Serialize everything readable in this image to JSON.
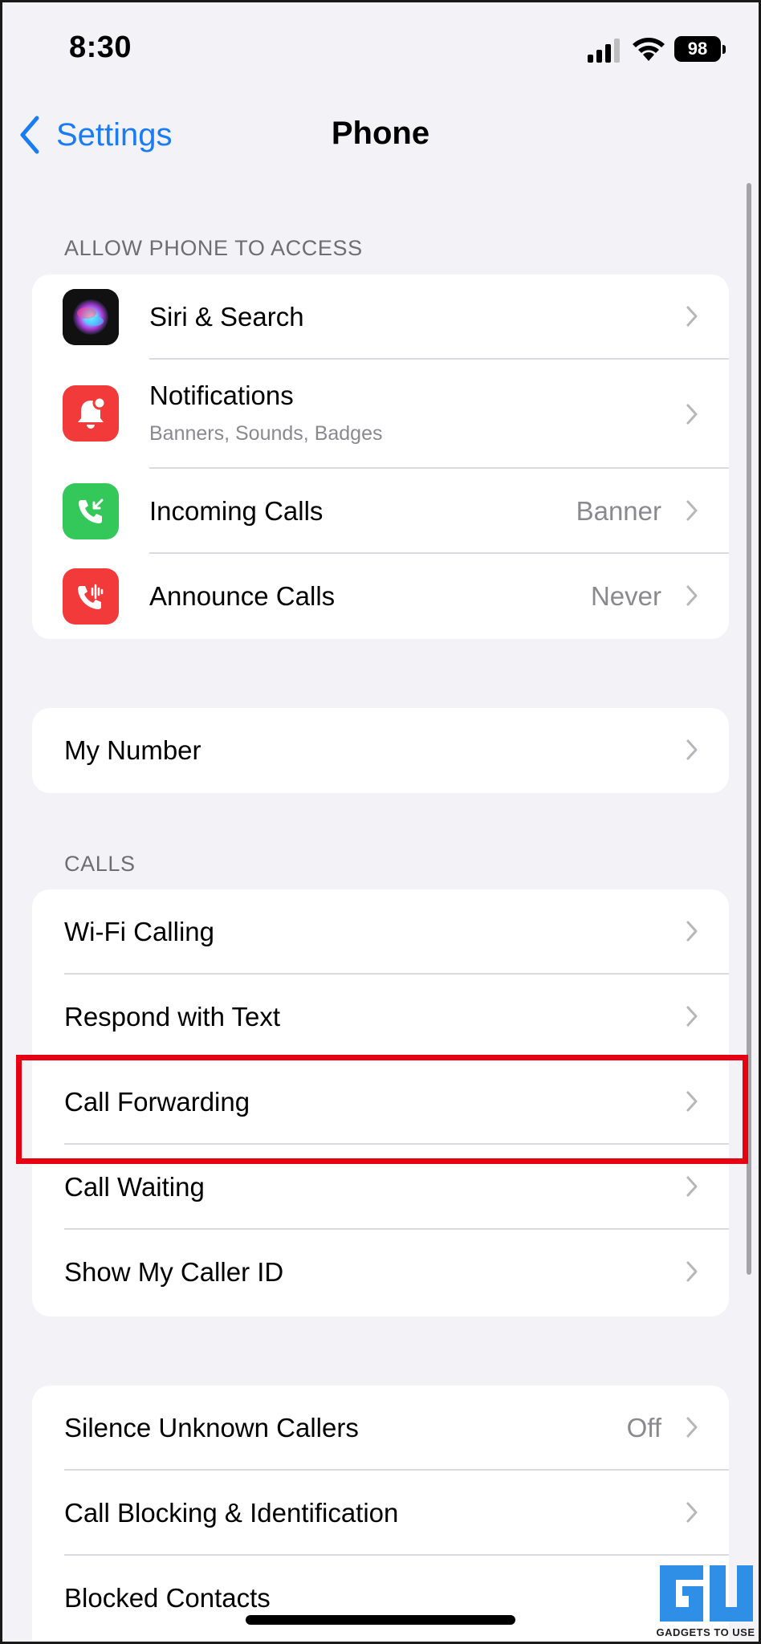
{
  "status_bar": {
    "time": "8:30",
    "battery": "98"
  },
  "nav": {
    "back_label": "Settings",
    "title": "Phone"
  },
  "sections": {
    "allow_access": {
      "header": "ALLOW PHONE TO ACCESS",
      "items": [
        {
          "label": "Siri & Search",
          "icon": "siri-icon"
        },
        {
          "label": "Notifications",
          "subtitle": "Banners, Sounds, Badges",
          "icon": "bell-icon",
          "icon_color": "#f23a3a"
        },
        {
          "label": "Incoming Calls",
          "value": "Banner",
          "icon": "incoming-call-icon",
          "icon_color": "#34c759"
        },
        {
          "label": "Announce Calls",
          "value": "Never",
          "icon": "announce-call-icon",
          "icon_color": "#f23a3a"
        }
      ]
    },
    "my_number": {
      "items": [
        {
          "label": "My Number"
        }
      ]
    },
    "calls": {
      "header": "CALLS",
      "items": [
        {
          "label": "Wi-Fi Calling"
        },
        {
          "label": "Respond with Text"
        },
        {
          "label": "Call Forwarding",
          "highlighted": true
        },
        {
          "label": "Call Waiting"
        },
        {
          "label": "Show My Caller ID"
        }
      ]
    },
    "blocking": {
      "items": [
        {
          "label": "Silence Unknown Callers",
          "value": "Off"
        },
        {
          "label": "Call Blocking & Identification"
        },
        {
          "label": "Blocked Contacts"
        }
      ]
    }
  },
  "watermark": {
    "text": "GADGETS TO USE"
  },
  "colors": {
    "accent": "#1a7cf5",
    "highlight": "#e60012",
    "background": "#f2f2f7"
  }
}
